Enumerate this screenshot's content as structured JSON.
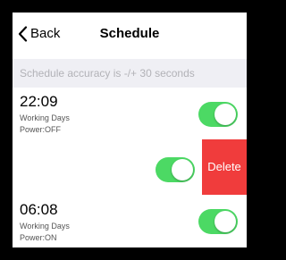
{
  "nav": {
    "back_label": "Back",
    "title": "Schedule"
  },
  "notice": {
    "text": "Schedule accuracy is -/+ 30 seconds"
  },
  "schedules": [
    {
      "time": "22:09",
      "repeat": "Working Days",
      "power": "Power:OFF",
      "enabled": true
    },
    {
      "enabled": true,
      "delete_label": "Delete"
    },
    {
      "time": "06:08",
      "repeat": "Working Days",
      "power": "Power:ON",
      "enabled": true
    }
  ],
  "colors": {
    "toggle_on": "#4cd964",
    "delete": "#f03c3c",
    "notice_bg": "#efeff4"
  }
}
